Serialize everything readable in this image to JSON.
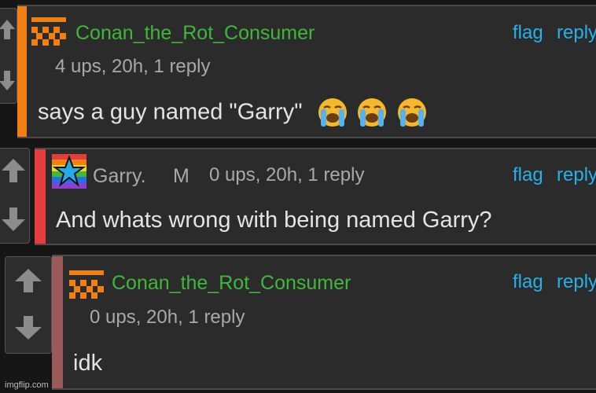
{
  "comments": [
    {
      "username": "Conan_the_Rot_Consumer",
      "meta": "4 ups, 20h, 1 reply",
      "text": "says a guy named \"Garry\"",
      "actions": {
        "flag": "flag",
        "reply": "reply"
      },
      "stripe_color": "#f17f13",
      "emoji": [
        "loudly-crying-face",
        "loudly-crying-face",
        "loudly-crying-face"
      ]
    },
    {
      "username": "Garry.",
      "badge": "M",
      "meta": "0 ups, 20h, 1 reply",
      "text": "And whats wrong with being named Garry?",
      "actions": {
        "flag": "flag",
        "reply": "reply"
      },
      "stripe_color": "#e53d3d"
    },
    {
      "username": "Conan_the_Rot_Consumer",
      "meta": "0 ups, 20h, 1 reply",
      "text": "idk",
      "actions": {
        "flag": "flag",
        "reply": "reply"
      },
      "stripe_color": "#9a5a5a"
    }
  ],
  "colors": {
    "username": "#3fb83a",
    "link": "#27b1ea",
    "avatar": "#f17f13"
  },
  "watermark": "imgflip.com"
}
